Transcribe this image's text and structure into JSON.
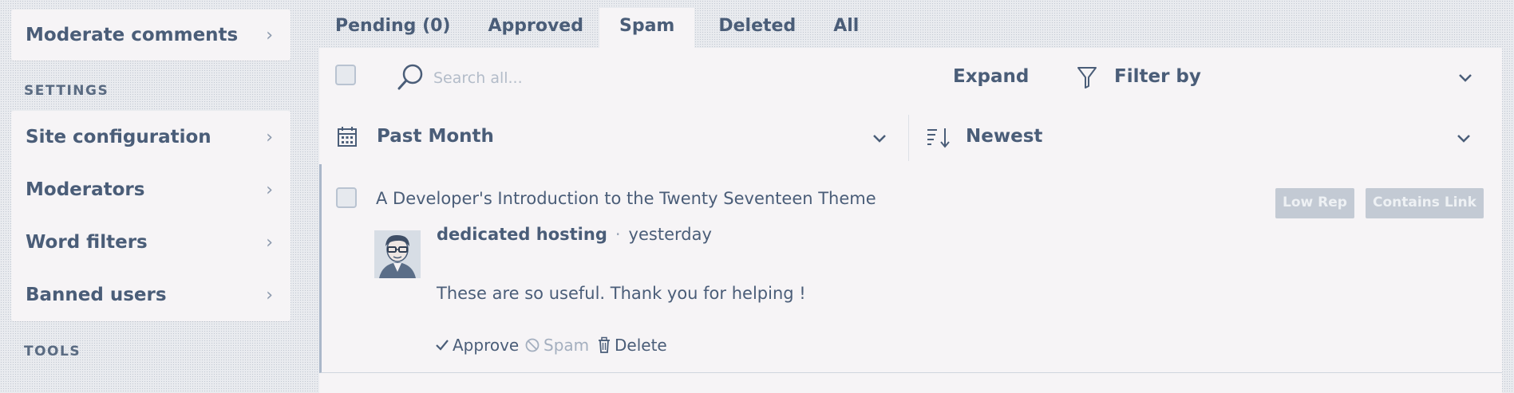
{
  "sidebar": {
    "moderate_label": "Moderate comments",
    "settings_heading": "SETTINGS",
    "settings_items": [
      {
        "label": "Site configuration"
      },
      {
        "label": "Moderators"
      },
      {
        "label": "Word filters"
      },
      {
        "label": "Banned users"
      }
    ],
    "tools_heading": "TOOLS"
  },
  "tabs": [
    {
      "label": "Pending (0)"
    },
    {
      "label": "Approved"
    },
    {
      "label": "Spam"
    },
    {
      "label": "Deleted"
    },
    {
      "label": "All"
    }
  ],
  "active_tab": "Spam",
  "toolbar": {
    "search_placeholder": "Search all...",
    "expand_label": "Expand",
    "filter_label": "Filter by",
    "date_value": "Past Month",
    "sort_value": "Newest"
  },
  "comment": {
    "post_title": "A Developer's Introduction to the Twenty Seventeen Theme",
    "badges": [
      "Low Rep",
      "Contains Link"
    ],
    "author": "dedicated hosting",
    "time": "yesterday",
    "body": "These are so useful. Thank you for helping !",
    "actions": {
      "approve": "Approve",
      "spam": "Spam",
      "delete": "Delete"
    }
  },
  "colors": {
    "text": "#4a5d78",
    "panel": "#f6f4f6",
    "badge": "#c3cad4",
    "accent_border": "#aab7c9"
  },
  "icons": [
    "chevron-right-icon",
    "search-icon",
    "filter-icon",
    "calendar-icon",
    "sort-icon",
    "chevron-down-icon",
    "check-icon",
    "spam-icon",
    "trash-icon"
  ]
}
